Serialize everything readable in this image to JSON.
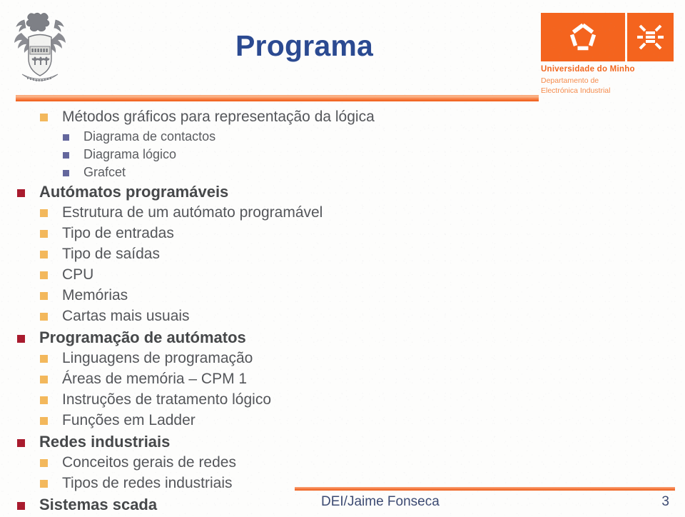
{
  "slide": {
    "title": "Programa",
    "title_color": "#2b4a91",
    "accent_color": "#ef5a15"
  },
  "header": {
    "crest_icon": "university-crest-icon",
    "logo": {
      "pentagon_icon": "pentagon-outline-icon",
      "burst_icon": "starburst-icon",
      "university": "Universidade do Minho",
      "department_line1": "Departamento de",
      "department_line2": "Electrónica Industrial",
      "brand_color": "#f4641e"
    }
  },
  "agenda": {
    "items": [
      {
        "level": 1,
        "text": "Métodos gráficos para representação da lógica",
        "bullet_color": "#f3b85c",
        "bold": false
      },
      {
        "level": 2,
        "text": "Diagrama de contactos",
        "bullet_color": "#64679d",
        "bold": false
      },
      {
        "level": 2,
        "text": "Diagrama lógico",
        "bullet_color": "#64679d",
        "bold": false
      },
      {
        "level": 2,
        "text": "Grafcet",
        "bullet_color": "#64679d",
        "bold": false
      },
      {
        "level": 0,
        "text": "Autómatos programáveis",
        "bullet_color": "#a91b2e",
        "bold": true
      },
      {
        "level": 1,
        "text": "Estrutura de um autómato programável",
        "bullet_color": "#f3b85c",
        "bold": false
      },
      {
        "level": 1,
        "text": "Tipo de entradas",
        "bullet_color": "#f3b85c",
        "bold": false
      },
      {
        "level": 1,
        "text": "Tipo de saídas",
        "bullet_color": "#f3b85c",
        "bold": false
      },
      {
        "level": 1,
        "text": "CPU",
        "bullet_color": "#f3b85c",
        "bold": false
      },
      {
        "level": 1,
        "text": "Memórias",
        "bullet_color": "#f3b85c",
        "bold": false
      },
      {
        "level": 1,
        "text": "Cartas mais usuais",
        "bullet_color": "#f3b85c",
        "bold": false
      },
      {
        "level": 0,
        "text": "Programação de autómatos",
        "bullet_color": "#a91b2e",
        "bold": true
      },
      {
        "level": 1,
        "text": "Linguagens de programação",
        "bullet_color": "#f3b85c",
        "bold": false
      },
      {
        "level": 1,
        "text": "Áreas de memória – CPM 1",
        "bullet_color": "#f3b85c",
        "bold": false
      },
      {
        "level": 1,
        "text": "Instruções de tratamento lógico",
        "bullet_color": "#f3b85c",
        "bold": false
      },
      {
        "level": 1,
        "text": "Funções em Ladder",
        "bullet_color": "#f3b85c",
        "bold": false
      },
      {
        "level": 0,
        "text": "Redes industriais",
        "bullet_color": "#a91b2e",
        "bold": true
      },
      {
        "level": 1,
        "text": "Conceitos gerais de redes",
        "bullet_color": "#f3b85c",
        "bold": false
      },
      {
        "level": 1,
        "text": "Tipos de redes industriais",
        "bullet_color": "#f3b85c",
        "bold": false
      },
      {
        "level": 0,
        "text": "Sistemas scada",
        "bullet_color": "#a91b2e",
        "bold": true
      }
    ]
  },
  "footer": {
    "author": "DEI/Jaime Fonseca",
    "page_number": "3"
  }
}
